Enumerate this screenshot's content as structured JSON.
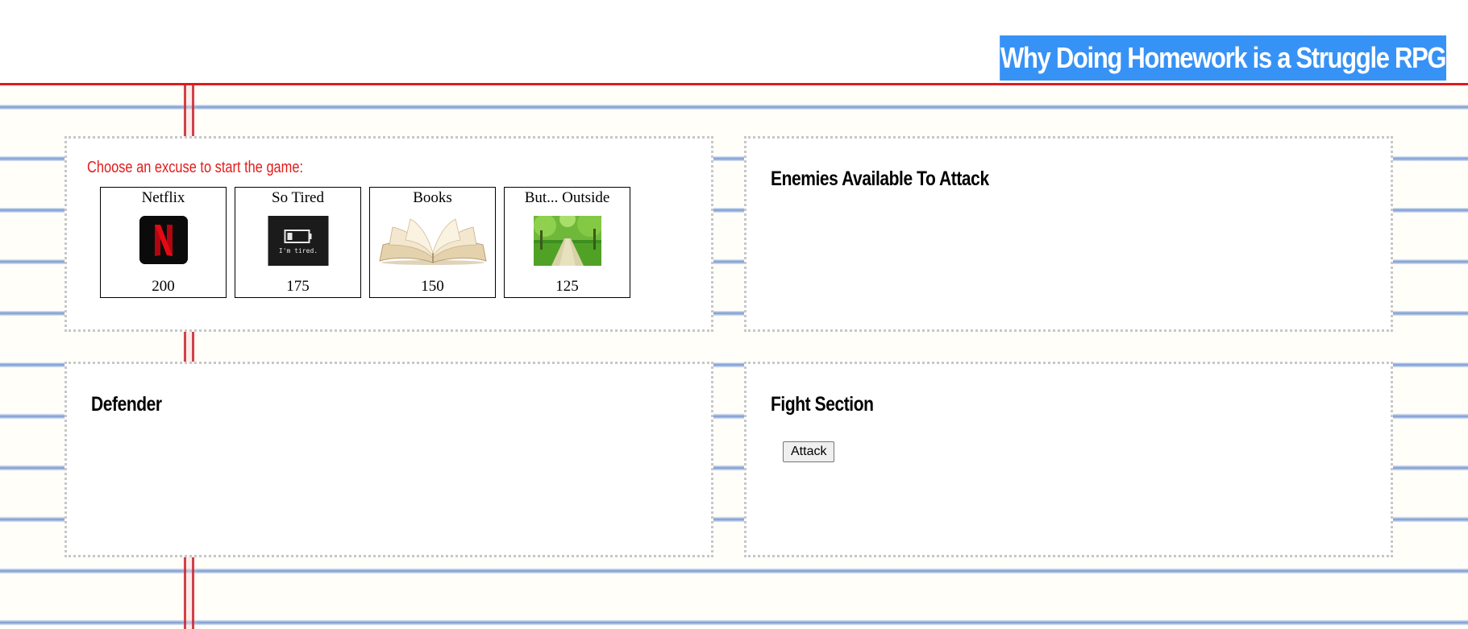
{
  "title": "Why Doing Homework is a Struggle RPG",
  "select_section": {
    "prompt": "Choose an excuse to start the game:",
    "characters": [
      {
        "name": "Netflix",
        "hp": "200",
        "icon": "netflix-logo-icon"
      },
      {
        "name": "So Tired",
        "hp": "175",
        "icon": "tired-battery-icon"
      },
      {
        "name": "Books",
        "hp": "150",
        "icon": "open-book-icon"
      },
      {
        "name": "But... Outside",
        "hp": "125",
        "icon": "outdoor-path-icon"
      }
    ]
  },
  "enemies_section": {
    "heading": "Enemies Available To Attack"
  },
  "defender_section": {
    "heading": "Defender"
  },
  "fight_section": {
    "heading": "Fight Section",
    "attack_label": "Attack"
  },
  "colors": {
    "title_background": "#3792f6",
    "prompt_text": "#e21b1b",
    "margin_line": "#e01b1b",
    "ruled_line": "#5f87cd"
  }
}
